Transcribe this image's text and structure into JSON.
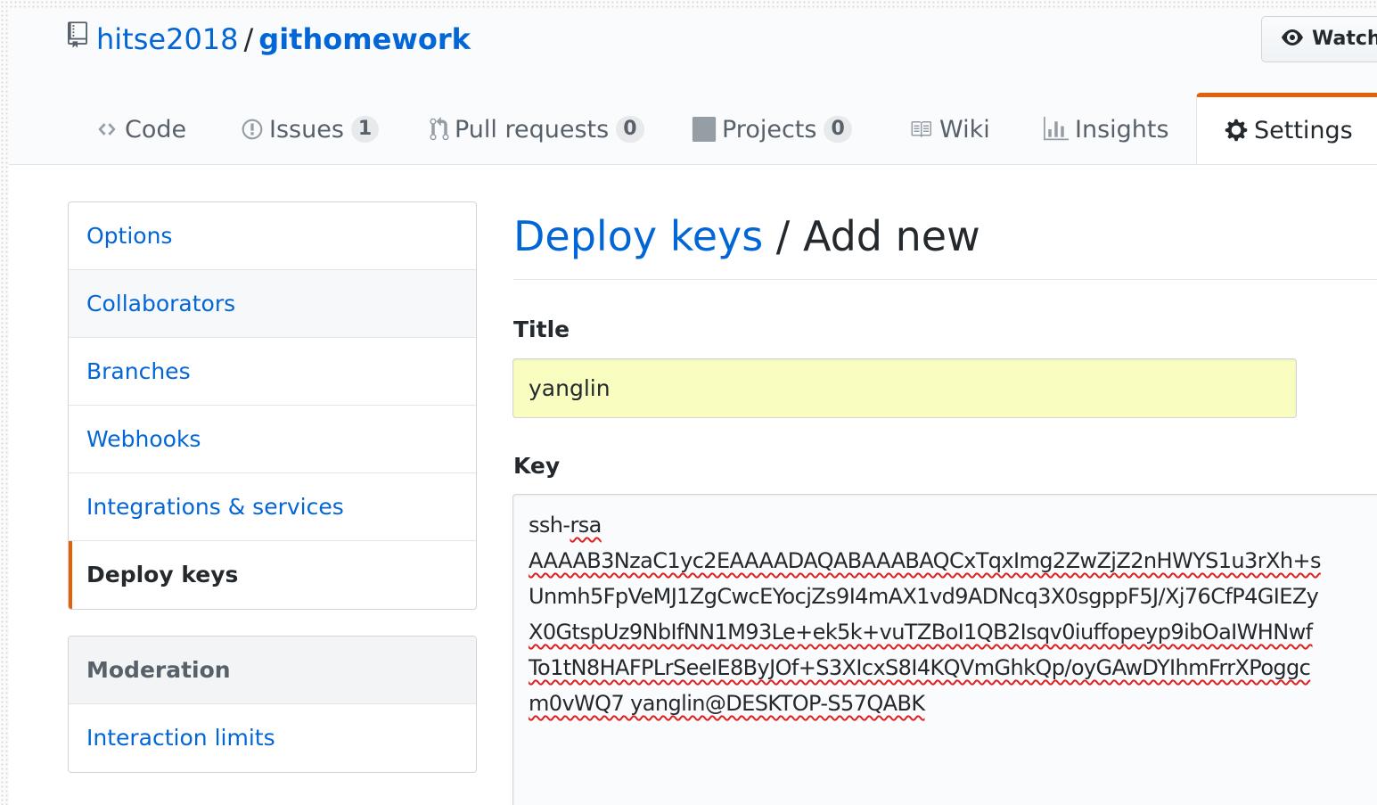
{
  "repo": {
    "owner": "hitse2018",
    "separator": "/",
    "name": "githomework"
  },
  "watch_button": {
    "label": "Watch"
  },
  "tabs": [
    {
      "label": "Code",
      "icon": "code-icon"
    },
    {
      "label": "Issues",
      "icon": "issue-icon",
      "count": "1"
    },
    {
      "label": "Pull requests",
      "icon": "pull-request-icon",
      "count": "0"
    },
    {
      "label": "Projects",
      "icon": "project-icon",
      "count": "0"
    },
    {
      "label": "Wiki",
      "icon": "book-icon"
    },
    {
      "label": "Insights",
      "icon": "graph-icon"
    },
    {
      "label": "Settings",
      "icon": "gear-icon",
      "selected": true
    }
  ],
  "sidebar": {
    "items": [
      {
        "label": "Options"
      },
      {
        "label": "Collaborators"
      },
      {
        "label": "Branches"
      },
      {
        "label": "Webhooks"
      },
      {
        "label": "Integrations & services"
      },
      {
        "label": "Deploy keys",
        "selected": true
      }
    ],
    "moderation": {
      "heading": "Moderation",
      "items": [
        {
          "label": "Interaction limits"
        }
      ]
    }
  },
  "main": {
    "breadcrumb_link": "Deploy keys",
    "breadcrumb_sep": " / ",
    "heading": "Add new",
    "title_label": "Title",
    "title_value": "yanglin",
    "key_label": "Key",
    "key_lines": [
      "ssh-rsa",
      "AAAAB3NzaC1yc2EAAAADAQABAAABAQCxTqxImg2ZwZjZ2nHWYS1u3rXh+s",
      "Unmh5FpVeMJ1ZgCwcEYocjZs9I4mAX1vd9ADNcq3X0sgppF5J/Xj76CfP4GIEZy",
      "X0GtspUz9NbIfNN1M93Le+ek5k+vuTZBoI1QB2Isqv0iuffopeyp9ibOaIWHNwf",
      "To1tN8HAFPLrSeeIE8ByJOf+S3XIcxS8I4KQVmGhkQp/oyGAwDYIhmFrrXPoggc",
      "m0vWQ7 yanglin@DESKTOP-S57QABK"
    ]
  },
  "colors": {
    "link": "#0366d6",
    "text": "#24292e",
    "accent": "#e36209",
    "autofill": "#fafdc0"
  }
}
